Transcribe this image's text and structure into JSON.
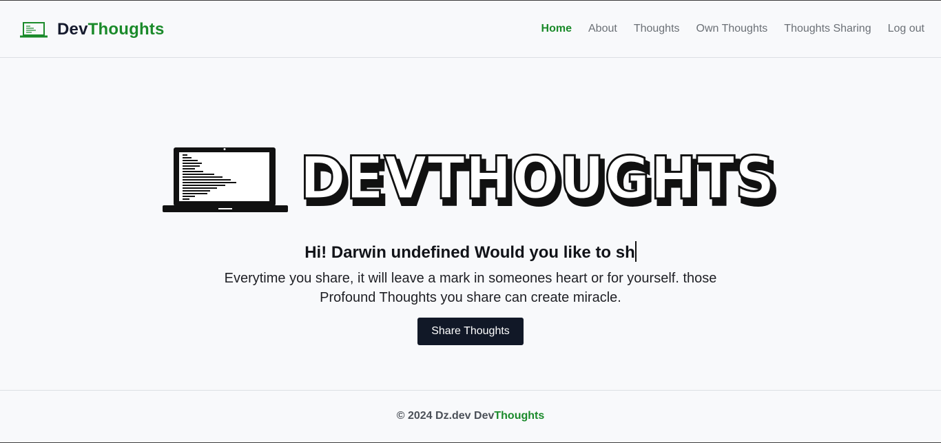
{
  "colors": {
    "accent": "#1a8a2a",
    "dark": "#111827",
    "text_muted": "#6b7076",
    "background": "#f8f9fb"
  },
  "header": {
    "brand": {
      "icon": "laptop-icon",
      "part1": "Dev",
      "part2": "Thoughts"
    },
    "nav": [
      {
        "label": "Home",
        "active": true
      },
      {
        "label": "About",
        "active": false
      },
      {
        "label": "Thoughts",
        "active": false
      },
      {
        "label": "Own Thoughts",
        "active": false
      },
      {
        "label": "Thoughts Sharing",
        "active": false
      },
      {
        "label": "Log out",
        "active": false
      }
    ]
  },
  "hero": {
    "logo_icon": "laptop-code-icon",
    "logo_text": "DEVTHOUGHTS",
    "greeting": "Hi! Darwin undefined Would you like to sh",
    "subtext": "Everytime you share, it will leave a mark in someones heart or for yourself. those Profound Thoughts you share can create miracle.",
    "button_label": "Share Thoughts"
  },
  "footer": {
    "prefix": "© 2024 Dz.dev Dev",
    "accent": "Thoughts"
  }
}
